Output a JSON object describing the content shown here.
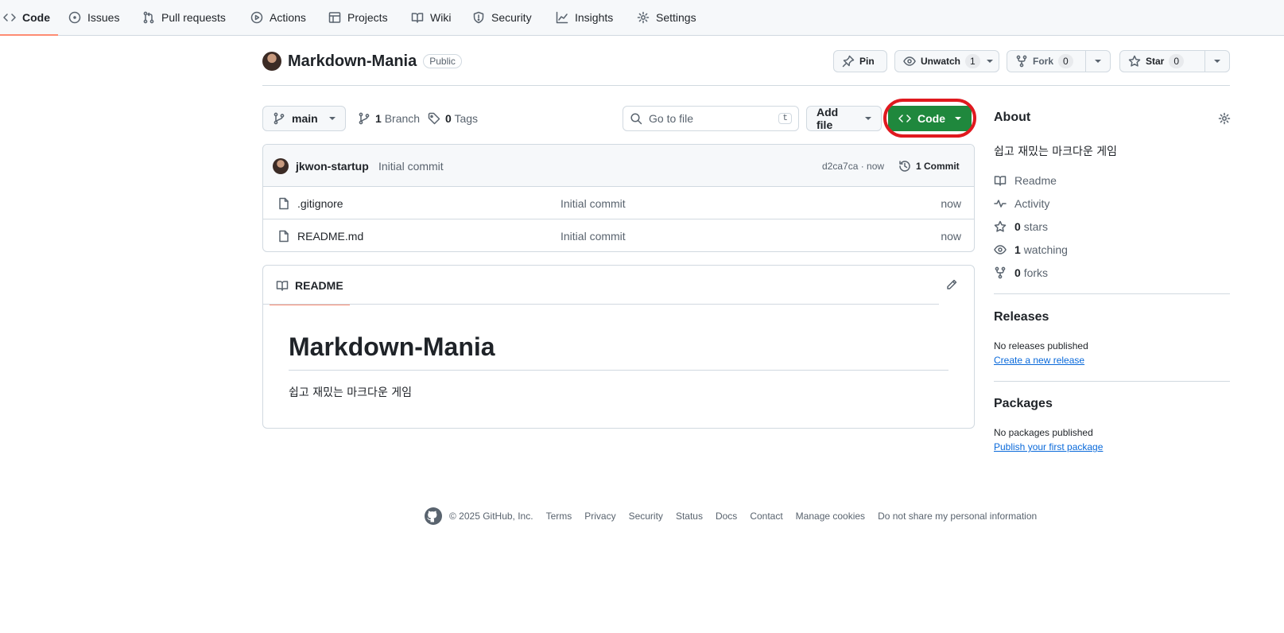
{
  "nav": {
    "tabs": [
      {
        "label": "Code",
        "icon": "code-icon",
        "active": true
      },
      {
        "label": "Issues",
        "icon": "issue-icon"
      },
      {
        "label": "Pull requests",
        "icon": "pull-request-icon"
      },
      {
        "label": "Actions",
        "icon": "play-icon"
      },
      {
        "label": "Projects",
        "icon": "table-icon"
      },
      {
        "label": "Wiki",
        "icon": "book-icon"
      },
      {
        "label": "Security",
        "icon": "shield-icon"
      },
      {
        "label": "Insights",
        "icon": "graph-icon"
      },
      {
        "label": "Settings",
        "icon": "gear-icon"
      }
    ]
  },
  "repo": {
    "name": "Markdown-Mania",
    "visibility": "Public",
    "pin_label": "Pin",
    "unwatch_label": "Unwatch",
    "watch_count": "1",
    "fork_label": "Fork",
    "fork_count": "0",
    "star_label": "Star",
    "star_count": "0"
  },
  "toolbar": {
    "branch": "main",
    "branch_count": "1",
    "branch_label": "Branch",
    "tag_count": "0",
    "tag_label": "Tags",
    "search_placeholder": "Go to file",
    "search_shortcut": "t",
    "add_file_label": "Add file",
    "code_label": "Code"
  },
  "commit": {
    "author": "jkwon-startup",
    "message": "Initial commit",
    "hash_time": "d2ca7ca · now",
    "commit_count_label": "1 Commit"
  },
  "files": [
    {
      "name": ".gitignore",
      "message": "Initial commit",
      "time": "now"
    },
    {
      "name": "README.md",
      "message": "Initial commit",
      "time": "now"
    }
  ],
  "readme": {
    "tab_label": "README",
    "heading": "Markdown-Mania",
    "body": "쉽고 재밌는 마크다운 게임"
  },
  "about": {
    "title": "About",
    "description": "쉽고 재밌는 마크다운 게임",
    "readme": "Readme",
    "activity": "Activity",
    "stars_count": "0",
    "stars_label": "stars",
    "watching_count": "1",
    "watching_label": "watching",
    "forks_count": "0",
    "forks_label": "forks"
  },
  "releases": {
    "title": "Releases",
    "empty": "No releases published",
    "link": "Create a new release"
  },
  "packages": {
    "title": "Packages",
    "empty": "No packages published",
    "link": "Publish your first package"
  },
  "footer": {
    "copyright": "© 2025 GitHub, Inc.",
    "links": [
      "Terms",
      "Privacy",
      "Security",
      "Status",
      "Docs",
      "Contact",
      "Manage cookies",
      "Do not share my personal information"
    ]
  },
  "colors": {
    "accent_green": "#1f883d",
    "highlight_ring": "#e0191f",
    "tab_underline": "#fd8c73",
    "link_blue": "#0969da"
  }
}
